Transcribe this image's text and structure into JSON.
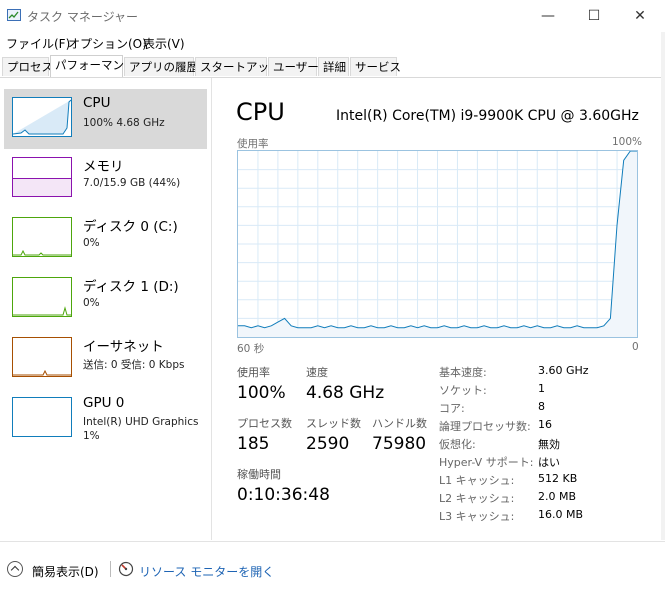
{
  "window": {
    "title": "タスク マネージャー",
    "minimize": "—",
    "maximize": "☐",
    "close": "✕"
  },
  "menu": [
    "ファイル(F)",
    "オプション(O)",
    "表示(V)"
  ],
  "tabs": [
    "プロセス",
    "パフォーマンス",
    "アプリの履歴",
    "スタートアップ",
    "ユーザー",
    "詳細",
    "サービス"
  ],
  "active_tab": "パフォーマンス",
  "resources": [
    {
      "name": "CPU",
      "line1": "100%  4.68 GHz",
      "line2": "",
      "color": "#117dbb"
    },
    {
      "name": "メモリ",
      "line1": "7.0/15.9 GB (44%)",
      "line2": "",
      "color": "#8b12ae"
    },
    {
      "name": "ディスク 0 (C:)",
      "line1": "0%",
      "line2": "",
      "color": "#4da60c"
    },
    {
      "name": "ディスク 1 (D:)",
      "line1": "0%",
      "line2": "",
      "color": "#4da60c"
    },
    {
      "name": "イーサネット",
      "line1": "送信: 0  受信: 0 Kbps",
      "line2": "",
      "color": "#a74f01"
    },
    {
      "name": "GPU 0",
      "line1": "Intel(R) UHD Graphics",
      "line2": "1%",
      "color": "#117dbb"
    }
  ],
  "main": {
    "title": "CPU",
    "model": "Intel(R) Core(TM) i9-9900K CPU @ 3.60GHz",
    "graph_label": "使用率",
    "graph_max": "100%",
    "graph_left": "60 秒",
    "graph_right": "0",
    "usage_series": [
      6,
      6,
      5,
      6,
      5,
      6,
      8,
      10,
      6,
      5,
      5,
      5,
      6,
      5,
      6,
      5,
      5,
      6,
      5,
      5,
      6,
      5,
      5,
      6,
      5,
      5,
      6,
      5,
      6,
      5,
      5,
      6,
      5,
      5,
      6,
      5,
      5,
      6,
      5,
      5,
      6,
      5,
      5,
      6,
      5,
      6,
      5,
      5,
      6,
      5,
      5,
      6,
      5,
      5,
      5,
      6,
      10,
      60,
      95,
      100,
      100
    ]
  },
  "stats": {
    "usage_label": "使用率",
    "usage": "100%",
    "speed_label": "速度",
    "speed": "4.68 GHz",
    "processes_label": "プロセス数",
    "processes": "185",
    "threads_label": "スレッド数",
    "threads": "2590",
    "handles_label": "ハンドル数",
    "handles": "75980",
    "uptime_label": "稼働時間",
    "uptime": "0:10:36:48"
  },
  "details": [
    {
      "label": "基本速度:",
      "value": "3.60 GHz"
    },
    {
      "label": "ソケット:",
      "value": "1"
    },
    {
      "label": "コア:",
      "value": "8"
    },
    {
      "label": "論理プロセッサ数:",
      "value": "16"
    },
    {
      "label": "仮想化:",
      "value": "無効"
    },
    {
      "label": "Hyper-V サポート:",
      "value": "はい"
    },
    {
      "label": "L1 キャッシュ:",
      "value": "512 KB"
    },
    {
      "label": "L2 キャッシュ:",
      "value": "2.0 MB"
    },
    {
      "label": "L3 キャッシュ:",
      "value": "16.0 MB"
    }
  ],
  "footer": {
    "collapse_label": "簡易表示(D)",
    "monitor_label": "リソース モニターを開く"
  },
  "icons": {
    "app": "task-manager-icon",
    "collapse": "chevron-up-icon",
    "monitor": "resource-monitor-icon"
  }
}
